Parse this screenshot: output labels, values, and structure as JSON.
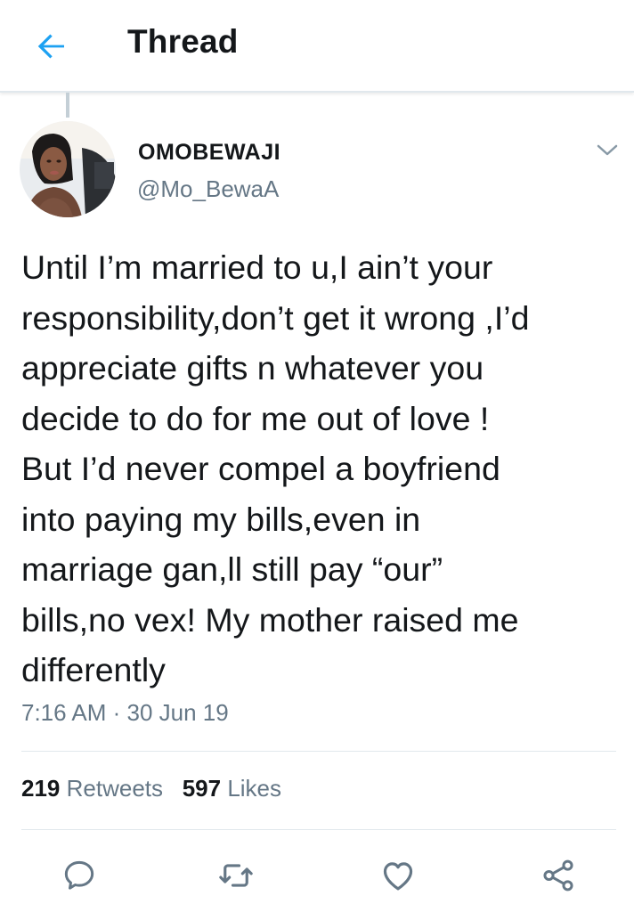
{
  "header": {
    "title": "Thread",
    "back_icon": "back-arrow-icon",
    "accent_color": "#1da1f2"
  },
  "tweet": {
    "display_name": "OMOBEWAJI",
    "handle": "@Mo_BewaA",
    "menu_icon": "chevron-down-icon",
    "text": "Until I’m married to u,I ain’t your\nresponsibility,don’t get it wrong ,I’d\nappreciate gifts n whatever you\ndecide to do for me out of love !\nBut I’d never compel a boyfriend\ninto paying my bills,even in\nmarriage gan,ll still pay “our”\nbills,no vex! My mother raised me\ndifferently",
    "timestamp": "7:16 AM · 30 Jun 19"
  },
  "stats": {
    "retweets_count": "219",
    "retweets_label": "Retweets",
    "likes_count": "597",
    "likes_label": "Likes"
  },
  "actions": [
    {
      "name": "reply",
      "icon": "reply-icon"
    },
    {
      "name": "retweet",
      "icon": "retweet-icon"
    },
    {
      "name": "like",
      "icon": "heart-icon"
    },
    {
      "name": "share",
      "icon": "share-icon"
    }
  ],
  "colors": {
    "text_primary": "#14171a",
    "text_secondary": "#657786",
    "divider": "#e1e8ed",
    "accent": "#1da1f2"
  }
}
